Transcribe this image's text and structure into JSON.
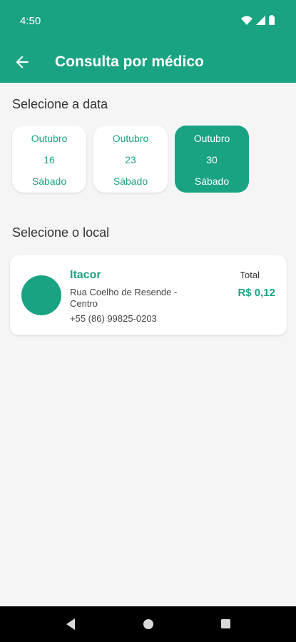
{
  "status": {
    "time": "4:50"
  },
  "appbar": {
    "title": "Consulta por médico"
  },
  "date_section": {
    "label": "Selecione a data"
  },
  "dates": [
    {
      "month": "Outubro",
      "day": "16",
      "weekday": "Sábado",
      "selected": false
    },
    {
      "month": "Outubro",
      "day": "23",
      "weekday": "Sábado",
      "selected": false
    },
    {
      "month": "Outubro",
      "day": "30",
      "weekday": "Sábado",
      "selected": true
    }
  ],
  "location_section": {
    "label": "Selecione o local"
  },
  "location": {
    "name": "Itacor",
    "address": "Rua Coelho de Resende - Centro",
    "phone": "+55 (86) 99825-0203",
    "total_label": "Total",
    "total_value": "R$ 0,12"
  },
  "colors": {
    "primary": "#1aa383",
    "background": "#f5f5f5"
  },
  "icons": {
    "back": "arrow-left-icon",
    "wifi": "wifi-icon",
    "signal": "signal-icon",
    "battery": "battery-icon"
  }
}
